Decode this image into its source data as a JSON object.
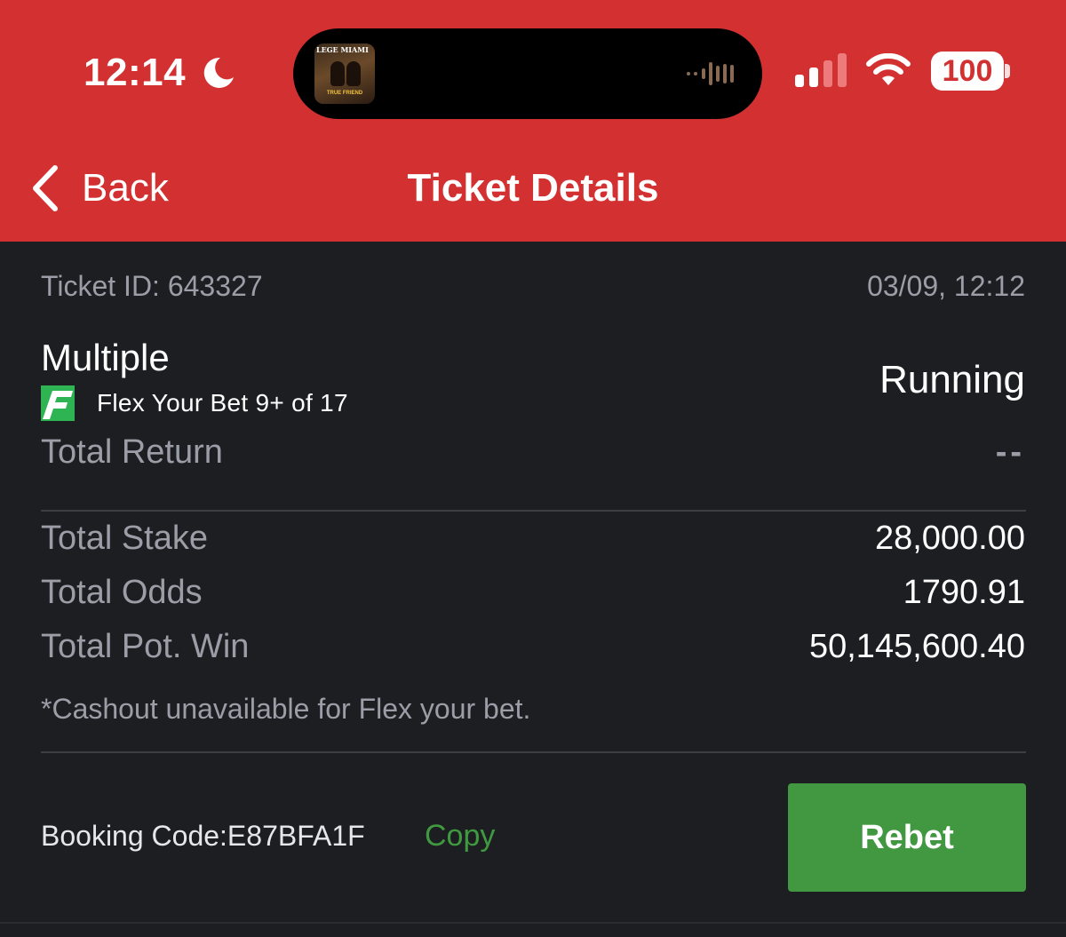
{
  "status_bar": {
    "time": "12:14",
    "battery": "100",
    "album_title": "LEGE MIAMI",
    "album_subtitle": "TRUE FRIEND"
  },
  "nav": {
    "back_label": "Back",
    "title": "Ticket Details"
  },
  "ticket": {
    "id_text": "Ticket ID: 643327",
    "date": "03/09, 12:12",
    "type": "Multiple",
    "flex_label": "Flex Your Bet 9+ of 17",
    "status": "Running",
    "total_return_label": "Total Return",
    "total_return_value": "--",
    "total_stake_label": "Total Stake",
    "total_stake_value": "28,000.00",
    "total_odds_label": "Total Odds",
    "total_odds_value": "1790.91",
    "total_pot_win_label": "Total Pot. Win",
    "total_pot_win_value": "50,145,600.40",
    "note": "*Cashout unavailable for Flex your bet."
  },
  "footer": {
    "booking_code_text": "Booking Code:E87BFA1F",
    "copy_label": "Copy",
    "rebet_label": "Rebet"
  },
  "colors": {
    "header": "#d33131",
    "background": "#1d1e22",
    "accent_green": "#419841",
    "muted_text": "#9b9ea7"
  },
  "icons": [
    "moon-icon",
    "waveform-icon",
    "signal-icon",
    "wifi-icon",
    "battery-icon",
    "back-chevron-icon",
    "flex-logo-icon"
  ]
}
